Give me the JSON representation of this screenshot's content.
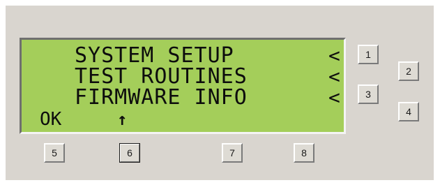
{
  "display": {
    "lines": [
      "SYSTEM SETUP",
      "TEST ROUTINES",
      "FIRMWARE INFO"
    ],
    "line_arrow": "<",
    "ok_label": "OK",
    "up_arrow": "↑"
  },
  "buttons": {
    "b1": "1",
    "b2": "2",
    "b3": "3",
    "b4": "4",
    "b5": "5",
    "b6": "6",
    "b7": "7",
    "b8": "8"
  },
  "colors": {
    "lcd_background": "#a4ce5a",
    "panel_background": "#d9d5cf"
  }
}
